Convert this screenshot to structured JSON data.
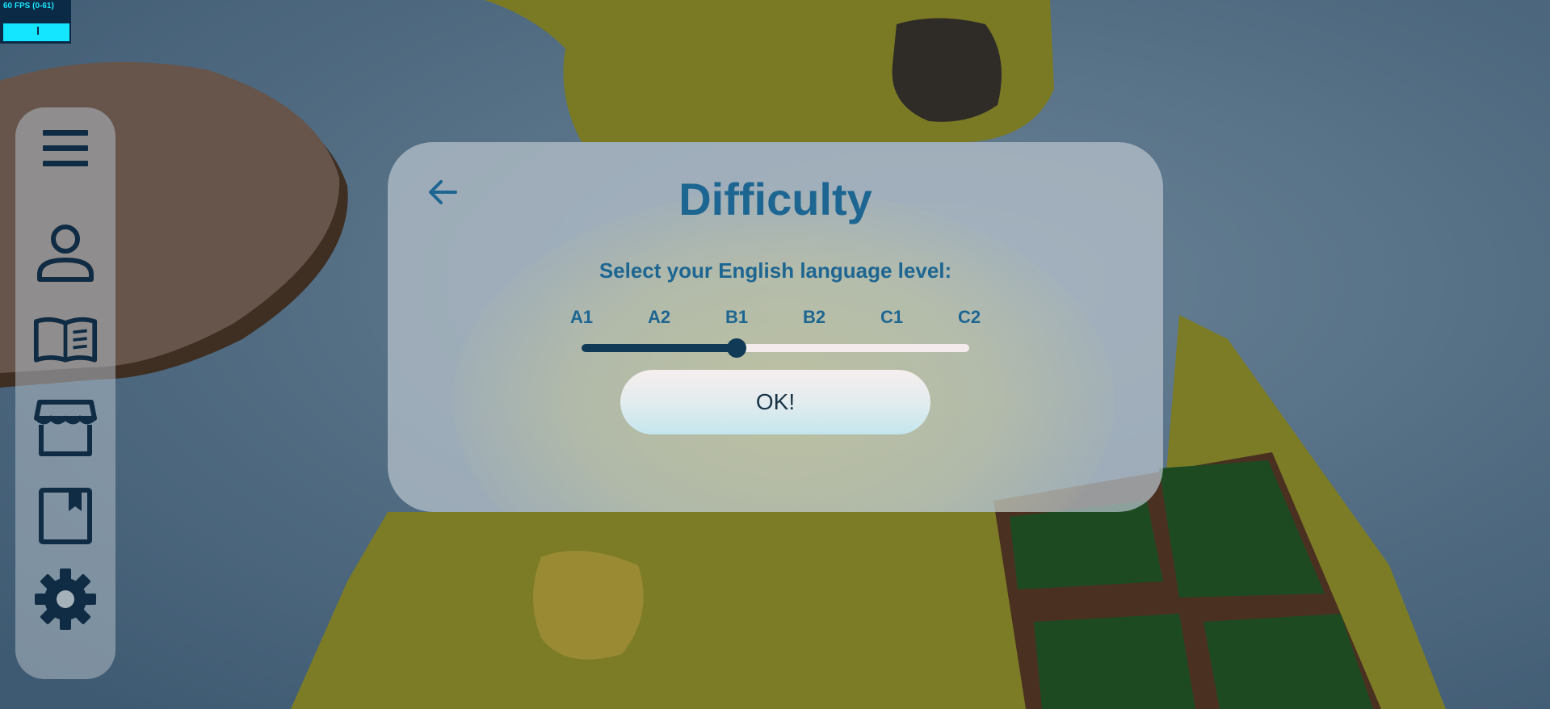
{
  "fps_meter": {
    "text": "60 FPS (0-61)"
  },
  "sidebar": {
    "items": [
      {
        "icon": "menu-icon"
      },
      {
        "icon": "profile-icon"
      },
      {
        "icon": "book-icon"
      },
      {
        "icon": "shop-icon"
      },
      {
        "icon": "bookmark-icon"
      },
      {
        "icon": "gear-icon"
      }
    ]
  },
  "dialog": {
    "back_icon": "back-arrow-icon",
    "title": "Difficulty",
    "subtitle": "Select your English language level:",
    "levels": [
      "A1",
      "A2",
      "B1",
      "B2",
      "C1",
      "C2"
    ],
    "selected_level": "B1",
    "ok_label": "OK!"
  },
  "colors": {
    "accent": "#1e6692",
    "dark": "#103a56",
    "icon": "#102c44"
  }
}
